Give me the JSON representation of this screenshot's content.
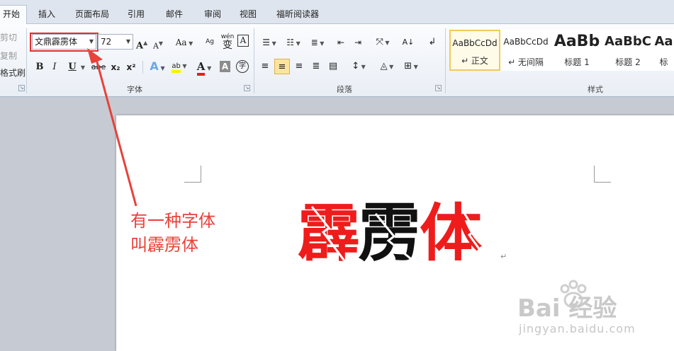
{
  "tabs": [
    "开始",
    "插入",
    "页面布局",
    "引用",
    "邮件",
    "审阅",
    "视图",
    "福昕阅读器"
  ],
  "clipboard": {
    "cut": "剪切",
    "copy": "复制",
    "format_painter": "格式刷"
  },
  "font": {
    "name": "文鼎霹雳体",
    "size": "72",
    "bold": "B",
    "italic": "I",
    "underline": "U",
    "strike": "abe",
    "subscript": "x₂",
    "superscript": "x²",
    "grow": "A",
    "shrink": "A",
    "case": "Aa",
    "font_color": "A",
    "shade": "A",
    "phonetic": "wén",
    "char_border": "A",
    "enclose": "字",
    "highlight": "ab"
  },
  "groups": {
    "font": "字体",
    "paragraph": "段落",
    "styles": "样式"
  },
  "styles": [
    {
      "sample": "AaBbCcDd",
      "name": "↵ 正文"
    },
    {
      "sample": "AaBbCcDd",
      "name": "↵ 无间隔"
    },
    {
      "sample": "AaBb",
      "name": "标题 1"
    },
    {
      "sample": "AaBbC",
      "name": "标题 2"
    },
    {
      "sample": "Aa",
      "name": "标"
    }
  ],
  "document": {
    "chars": [
      "霹",
      "雳",
      "体"
    ],
    "annotation_line1": "有一种字体",
    "annotation_line2": "叫霹雳体",
    "para_mark": "↵"
  },
  "watermark": {
    "logo": "Bai 经验",
    "url": "jingyan.baidu.com"
  },
  "colors": {
    "accent_red": "#ef1c1c",
    "annotation_red": "#e8423a",
    "ribbon_bg": "#eef2f7"
  }
}
